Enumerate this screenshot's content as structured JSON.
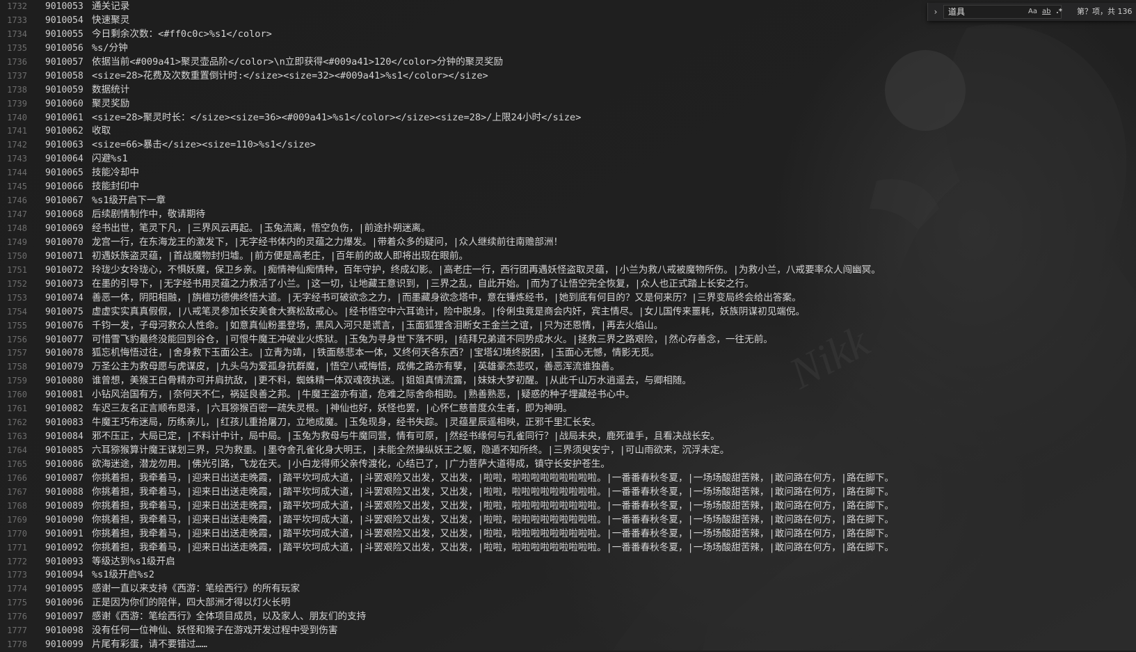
{
  "find_widget": {
    "query": "道具",
    "match_case_label": "Aa",
    "whole_word_label": "ab",
    "regex_label": ".*",
    "result_count": "第？项，共 136"
  },
  "lines": [
    {
      "n": "1732",
      "key": "9010053",
      "text": "通关记录"
    },
    {
      "n": "1733",
      "key": "9010054",
      "text": "快速聚灵"
    },
    {
      "n": "1734",
      "key": "9010055",
      "text": "今日剩余次数：<#ff0c0c>%s1</color>"
    },
    {
      "n": "1735",
      "key": "9010056",
      "text": "%s/分钟"
    },
    {
      "n": "1736",
      "key": "9010057",
      "text": "依据当前<#009a41>聚灵壶品阶</color>\\n立即获得<#009a41>120</color>分钟的聚灵奖励"
    },
    {
      "n": "1737",
      "key": "9010058",
      "text": "<size=28>花费及次数重置倒计时:</size><size=32><#009a41>%s1</color></size>"
    },
    {
      "n": "1738",
      "key": "9010059",
      "text": "数据统计"
    },
    {
      "n": "1739",
      "key": "9010060",
      "text": "聚灵奖励"
    },
    {
      "n": "1740",
      "key": "9010061",
      "text": "<size=28>聚灵时长：</size><size=36><#009a41>%s1</color></size><size=28>/上限24小时</size>"
    },
    {
      "n": "1741",
      "key": "9010062",
      "text": "收取"
    },
    {
      "n": "1742",
      "key": "9010063",
      "text": "<size=66>暴击</size><size=110>%s1</size>"
    },
    {
      "n": "1743",
      "key": "9010064",
      "text": "闪避%s1"
    },
    {
      "n": "1744",
      "key": "9010065",
      "text": "技能冷却中"
    },
    {
      "n": "1745",
      "key": "9010066",
      "text": "技能封印中"
    },
    {
      "n": "1746",
      "key": "9010067",
      "text": "%s1级开启下一章"
    },
    {
      "n": "1747",
      "key": "9010068",
      "text": "后续剧情制作中，敬请期待"
    },
    {
      "n": "1748",
      "key": "9010069",
      "text": "经书出世，笔灵下凡，|三界风云再起。|玉兔流离，悟空负伤，|前途扑朔迷离。"
    },
    {
      "n": "1749",
      "key": "9010070",
      "text": "龙宫一行，在东海龙王的激发下，|无字经书体内的灵蕴之力爆发。|带着众多的疑问，|众人继续前往南赡部洲！"
    },
    {
      "n": "1750",
      "key": "9010071",
      "text": "初遇妖族盗灵蕴，|首战魔物封归墟。|前方便是高老庄，|百年前的故人即将出现在眼前。"
    },
    {
      "n": "1751",
      "key": "9010072",
      "text": "玲珑少女玲珑心，不惧妖魔，保卫乡亲。|痴情神仙痴情种，百年守护，终成幻影。|高老庄一行，西行团再遇妖怪盗取灵蕴，|小兰为救八戒被魔物所伤。|为救小兰，八戒要率众人闯幽冥。"
    },
    {
      "n": "1752",
      "key": "9010073",
      "text": "在墨的引导下，|无字经书用灵蕴之力救活了小兰。|这一切，让地藏王意识到，|三界之乱，自此开始。|而为了让悟空完全恢复，|众人也正式踏上长安之行。"
    },
    {
      "n": "1753",
      "key": "9010074",
      "text": "善恶一体，阴阳相融，|旃檀功德佛终悟大道。|无字经书可破欲念之力，|而墨藏身欲念塔中，意在锤炼经书，|她到底有何目的？又是何来历？|三界变局终会给出答案。"
    },
    {
      "n": "1754",
      "key": "9010075",
      "text": "虚虚实实真真假假，|八戒笔灵参加长安美食大赛松敌戒心。|经书悟空中六耳诡计，险中脱身。|伶俐虫竟是商会内奸，宾主情尽。|女儿国传来噩耗，妖族阴谋初见端倪。"
    },
    {
      "n": "1755",
      "key": "9010076",
      "text": "千钧一发，子母河救众人性命。|如意真仙粉墨登场，黑风入河只是谎言，|玉面狐狸含泪断女王金兰之谊，|只为还恩情，|再去火焰山。"
    },
    {
      "n": "1756",
      "key": "9010077",
      "text": "可惜雪飞豹最终没能回到谷仓，|可恨牛魔王冲破业火炼狱。|玉兔为寻身世下落不明，|结拜兄弟道不同势成水火。|拯救三界之路艰险，|然心存善念，一往无前。"
    },
    {
      "n": "1757",
      "key": "9010078",
      "text": "狐忘机悔悟过往，|舍身救下玉面公主。|立青为靖，|铁面慈悲本一体，又终何天各东西？|宝塔幻境终脱困，|玉面心无憾，情影无觅。"
    },
    {
      "n": "1758",
      "key": "9010079",
      "text": "万圣公主为救母愿与虎谋皮，|九头乌为爱孤身抗群魔，|悟空八戒悔悟，成佛之路亦有孽，|英雄豪杰悲叹，善恶浑流谁独善。"
    },
    {
      "n": "1759",
      "key": "9010080",
      "text": "谁曾想，美猴王白骨精亦可并肩抗敌，|更不料，蜘蛛精一体双魂夜执迷。|姐姐真情流露，|妹妹大梦初醒。|从此千山万水逍遥去，与卿相随。"
    },
    {
      "n": "1760",
      "key": "9010081",
      "text": "小钻风治国有方，|奈何天不仁，祸延良善之邦。|牛魔王盗亦有道，危难之际舍命相助。|熟善熟恶，|疑惑的种子埋藏经书心中。"
    },
    {
      "n": "1761",
      "key": "9010082",
      "text": "车迟三友名正言顺布恩泽，|六耳猕猴百密一疏失灵根。|神仙也好，妖怪也罢，|心怀仁慈普度众生者，即为神明。"
    },
    {
      "n": "1762",
      "key": "9010083",
      "text": "牛魔王巧布迷局，历练亲儿，|红孩儿重拾屠刀，立地成魔。|玉兔现身，经书失踪。|灵蕴星辰遥相映，正邪千里汇长安。"
    },
    {
      "n": "1763",
      "key": "9010084",
      "text": "邪不压正，大局已定，|不料计中计，局中局。|玉兔为救母与牛魔同营，情有可原，|然经书缘何与孔雀同行？|战局未央，鹿死谁手，且看决战长安。"
    },
    {
      "n": "1764",
      "key": "9010085",
      "text": "六耳猕猴算计魔王谋划三界，只为救墨。|墨夺舍孔雀化身大明王，|未能全然操纵妖王之躯，隐遁不知所终。|三界须臾安宁，|可山雨欲来，沉浮未定。"
    },
    {
      "n": "1765",
      "key": "9010086",
      "text": "欲海迷途，潜龙勿用。|佛光引路，飞龙在天。|小白龙得师父亲传渡化，心结已了，|广力菩萨大道得成，镇守长安护苍生。"
    },
    {
      "n": "1766",
      "key": "9010087",
      "text": "你挑着担，我牵着马，|迎来日出送走晚霞，|踏平坎坷成大道，|斗罢艰险又出发，又出发，|啦啦，啦啦啦啦啦啦啦啦啦。|一番番春秋冬夏，|一场场酸甜苦辣，|敢问路在何方，|路在脚下。"
    },
    {
      "n": "1767",
      "key": "9010088",
      "text": "你挑着担，我牵着马，|迎来日出送走晚霞，|踏平坎坷成大道，|斗罢艰险又出发，又出发，|啦啦，啦啦啦啦啦啦啦啦啦。|一番番春秋冬夏，|一场场酸甜苦辣，|敢问路在何方，|路在脚下。"
    },
    {
      "n": "1768",
      "key": "9010089",
      "text": "你挑着担，我牵着马，|迎来日出送走晚霞，|踏平坎坷成大道，|斗罢艰险又出发，又出发，|啦啦，啦啦啦啦啦啦啦啦啦。|一番番春秋冬夏，|一场场酸甜苦辣，|敢问路在何方，|路在脚下。"
    },
    {
      "n": "1769",
      "key": "9010090",
      "text": "你挑着担，我牵着马，|迎来日出送走晚霞，|踏平坎坷成大道，|斗罢艰险又出发，又出发，|啦啦，啦啦啦啦啦啦啦啦啦。|一番番春秋冬夏，|一场场酸甜苦辣，|敢问路在何方，|路在脚下。"
    },
    {
      "n": "1770",
      "key": "9010091",
      "text": "你挑着担，我牵着马，|迎来日出送走晚霞，|踏平坎坷成大道，|斗罢艰险又出发，又出发，|啦啦，啦啦啦啦啦啦啦啦啦。|一番番春秋冬夏，|一场场酸甜苦辣，|敢问路在何方，|路在脚下。"
    },
    {
      "n": "1771",
      "key": "9010092",
      "text": "你挑着担，我牵着马，|迎来日出送走晚霞，|踏平坎坷成大道，|斗罢艰险又出发，又出发，|啦啦，啦啦啦啦啦啦啦啦啦。|一番番春秋冬夏，|一场场酸甜苦辣，|敢问路在何方，|路在脚下。"
    },
    {
      "n": "1772",
      "key": "9010093",
      "text": "等级达到%s1级开启"
    },
    {
      "n": "1773",
      "key": "9010094",
      "text": "%s1级开启%s2"
    },
    {
      "n": "1774",
      "key": "9010095",
      "text": "感谢一直以来支持《西游：笔绘西行》的所有玩家"
    },
    {
      "n": "1775",
      "key": "9010096",
      "text": "正是因为你们的陪伴，四大部洲才得以灯火长明"
    },
    {
      "n": "1776",
      "key": "9010097",
      "text": "感谢《西游：笔绘西行》全体项目成员，以及家人、朋友们的支持"
    },
    {
      "n": "1777",
      "key": "9010098",
      "text": "没有任何一位神仙、妖怪和猴子在游戏开发过程中受到伤害"
    },
    {
      "n": "1778",
      "key": "9010099",
      "text": "片尾有彩蛋，请不要错过……"
    }
  ]
}
